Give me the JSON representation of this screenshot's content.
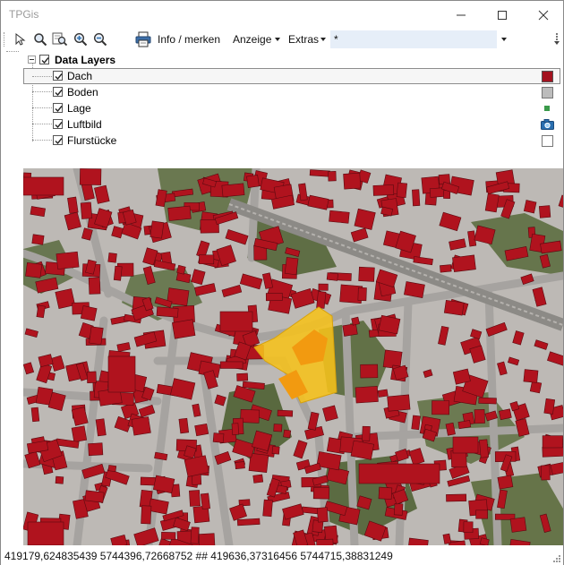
{
  "window": {
    "title": "TPGis",
    "minimize_glyph": "—",
    "maximize_glyph": "☐",
    "close_glyph": "✕"
  },
  "toolbar": {
    "icons": [
      "pointer-icon",
      "zoom-icon",
      "zoom-area-icon",
      "zoom-in-icon",
      "zoom-out-icon",
      "print-icon"
    ],
    "info_label": "Info / merken",
    "anzeige_label": "Anzeige",
    "extras_label": "Extras",
    "filter_value": "*"
  },
  "layers": {
    "root_label": "Data Layers",
    "root_checked": true,
    "items": [
      {
        "label": "Dach",
        "checked": true,
        "selected": true,
        "swatch_color": "#a3121f",
        "swatch_type": "filled-square"
      },
      {
        "label": "Boden",
        "checked": true,
        "selected": false,
        "swatch_color": "#bcbcbc",
        "swatch_type": "filled-square"
      },
      {
        "label": "Lage",
        "checked": true,
        "selected": false,
        "swatch_color": "#3a9a4a",
        "swatch_type": "small-dot"
      },
      {
        "label": "Luftbild",
        "checked": true,
        "selected": false,
        "swatch_color": "#2a6fb0",
        "swatch_type": "image-icon"
      },
      {
        "label": "Flurstücke",
        "checked": true,
        "selected": false,
        "swatch_color": "#ffffff",
        "swatch_type": "outline-square"
      }
    ]
  },
  "map": {
    "colors": {
      "roof": "#b0131e",
      "ground": "#bdb9b5",
      "road": "#aaa7a4",
      "green": "#5d6d3f",
      "highlight": "#f6c21b",
      "highlight_dark": "#f29a10",
      "rail": "#8c8a86"
    }
  },
  "status": {
    "coordinates": "419179,624835439  5744396,72668752 ## 419636,37316456  5744715,38831249"
  }
}
